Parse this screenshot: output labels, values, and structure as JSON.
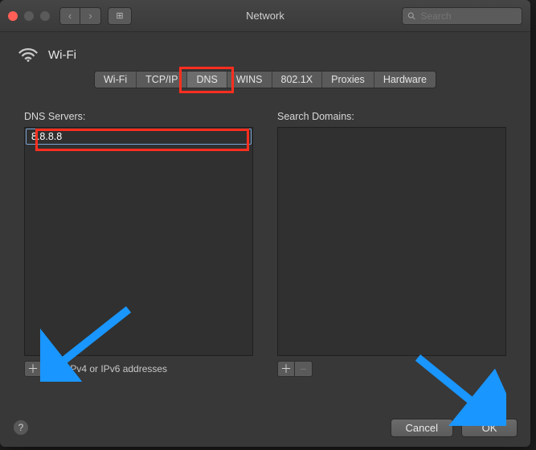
{
  "window": {
    "title": "Network"
  },
  "search": {
    "placeholder": "Search"
  },
  "header": {
    "title": "Wi-Fi"
  },
  "tabs": {
    "items": [
      "Wi-Fi",
      "TCP/IP",
      "DNS",
      "WINS",
      "802.1X",
      "Proxies",
      "Hardware"
    ],
    "active_index": 2
  },
  "dns_panel": {
    "label": "DNS Servers:",
    "entries": [
      "8.8.8.8"
    ],
    "hint": "IPv4 or IPv6 addresses"
  },
  "search_domains_panel": {
    "label": "Search Domains:",
    "entries": []
  },
  "buttons": {
    "cancel_label": "Cancel",
    "ok_label": "OK"
  },
  "glyphs": {
    "plus": "＋",
    "minus": "−",
    "help": "?",
    "chevL": "‹",
    "chevR": "›",
    "grid": "⊞"
  },
  "colors": {
    "annotation_red": "#ff2e1f",
    "annotation_blue": "#1996ff",
    "selection_border": "#7aa6d8"
  }
}
